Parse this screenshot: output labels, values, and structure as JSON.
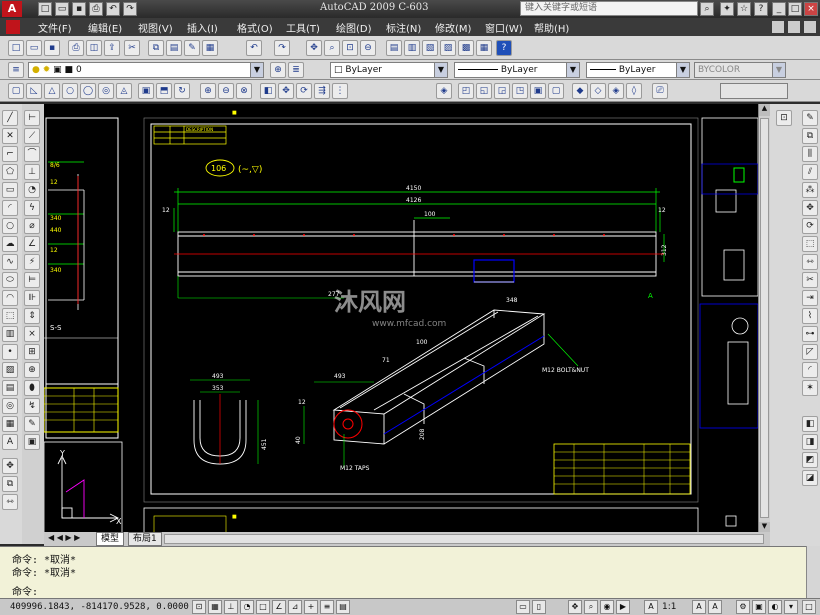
{
  "window": {
    "title": "AutoCAD 2009  C-603",
    "search_placeholder": "键入关键字或短语"
  },
  "menus": [
    "文件(F)",
    "编辑(E)",
    "视图(V)",
    "插入(I)",
    "格式(O)",
    "工具(T)",
    "绘图(D)",
    "标注(N)",
    "修改(M)",
    "窗口(W)",
    "帮助(H)"
  ],
  "layer": {
    "current": "0"
  },
  "properties": {
    "color": "ByLayer",
    "linetype": "ByLayer",
    "lineweight": "ByLayer",
    "plotstyle": "BYCOLOR"
  },
  "drawing": {
    "section_marker": "106",
    "section_symbols": "(~,▽)",
    "dim_overall": "4150",
    "dim_inner": "4126",
    "dim_left": "12",
    "dim_right": "12",
    "dim_mid": "100",
    "dim_height": "312",
    "dim_277": "277",
    "dim_348": "348",
    "dim_493_left": "493",
    "dim_353": "353",
    "dim_451": "451",
    "dim_493_right": "493",
    "dim_12z": "12",
    "dim_100": "100",
    "dim_71": "71",
    "dim_208": "208",
    "dim_40": "40",
    "callout_bolt": "M12 BOLT&NUT",
    "callout_taps": "M12 TAPS",
    "mark_a": "A",
    "mark_ss": "S-S",
    "left_dims": [
      "8/6",
      "12",
      "340",
      "440",
      "12",
      "340"
    ],
    "title_block_header": "DESCRIPTION",
    "logo_text": "沐风网",
    "logo_url": "www.mfcad.com",
    "axis_y": "Y",
    "axis_x": "X"
  },
  "tabs": [
    "模型",
    "布局1"
  ],
  "command": {
    "lines": [
      "命令: *取消*",
      "命令: *取消*",
      "命令:"
    ]
  },
  "status": {
    "coords": "409996.1843, -814170.9528, 0.0000",
    "scale": "1:1"
  },
  "colors": {
    "canvas": "#000000",
    "frame": "#ffffff",
    "dim": "#00ff00",
    "geometry": "#ffffff",
    "centerline": "#ff0000",
    "viewport": "#0000ff",
    "yellow": "#ffff00"
  }
}
